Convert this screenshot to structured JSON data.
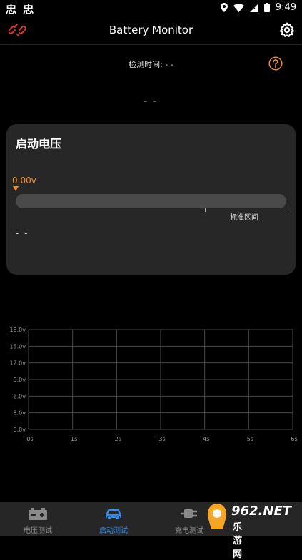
{
  "status_bar": {
    "left_text": "忠 忠",
    "time": "9:49"
  },
  "app_bar": {
    "title": "Battery Monitor"
  },
  "detect": {
    "text": "检测时间: - -"
  },
  "main_value": "- -",
  "card": {
    "title": "启动电压",
    "pointer_value": "0.00v",
    "range_label": "标准区间",
    "value": "- -"
  },
  "chart_data": {
    "type": "line",
    "title": "",
    "xlabel": "",
    "ylabel": "",
    "x_ticks": [
      "0s",
      "1s",
      "2s",
      "3s",
      "4s",
      "5s",
      "6s"
    ],
    "y_ticks": [
      "0.0v",
      "3.0v",
      "6.0v",
      "9.0v",
      "12.0v",
      "15.0v",
      "18.0v"
    ],
    "xlim": [
      0,
      6
    ],
    "ylim": [
      0,
      18
    ],
    "grid": true,
    "series": []
  },
  "tabs": [
    {
      "label": "电压测试",
      "icon": "battery-icon"
    },
    {
      "label": "启动测试",
      "icon": "car-icon"
    },
    {
      "label": "充电测试",
      "icon": "plug-icon"
    }
  ],
  "watermark": {
    "text": "962.NET",
    "sub": "乐游网"
  },
  "colors": {
    "accent_orange": "#f08a24",
    "active_blue": "#2f8df5",
    "card_bg": "#272727"
  }
}
